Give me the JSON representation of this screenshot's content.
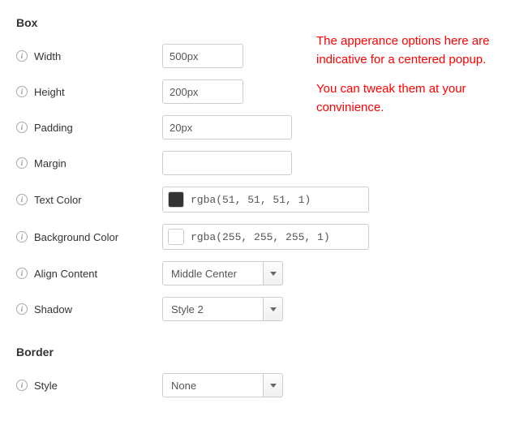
{
  "sections": {
    "box_title": "Box",
    "border_title": "Border"
  },
  "note": {
    "line1": "The apperance options here are indicative for a centered popup.",
    "line2": "You can tweak them at your convinience."
  },
  "fields": {
    "width": {
      "label": "Width",
      "value": "500px"
    },
    "height": {
      "label": "Height",
      "value": "200px"
    },
    "padding": {
      "label": "Padding",
      "value": "20px"
    },
    "margin": {
      "label": "Margin",
      "value": ""
    },
    "text_color": {
      "label": "Text Color",
      "value": "rgba(51, 51, 51, 1)",
      "swatch": "#333333"
    },
    "background_color": {
      "label": "Background Color",
      "value": "rgba(255, 255, 255, 1)",
      "swatch": "#ffffff"
    },
    "align_content": {
      "label": "Align Content",
      "value": "Middle Center"
    },
    "shadow": {
      "label": "Shadow",
      "value": "Style 2"
    },
    "border_style": {
      "label": "Style",
      "value": "None"
    }
  }
}
